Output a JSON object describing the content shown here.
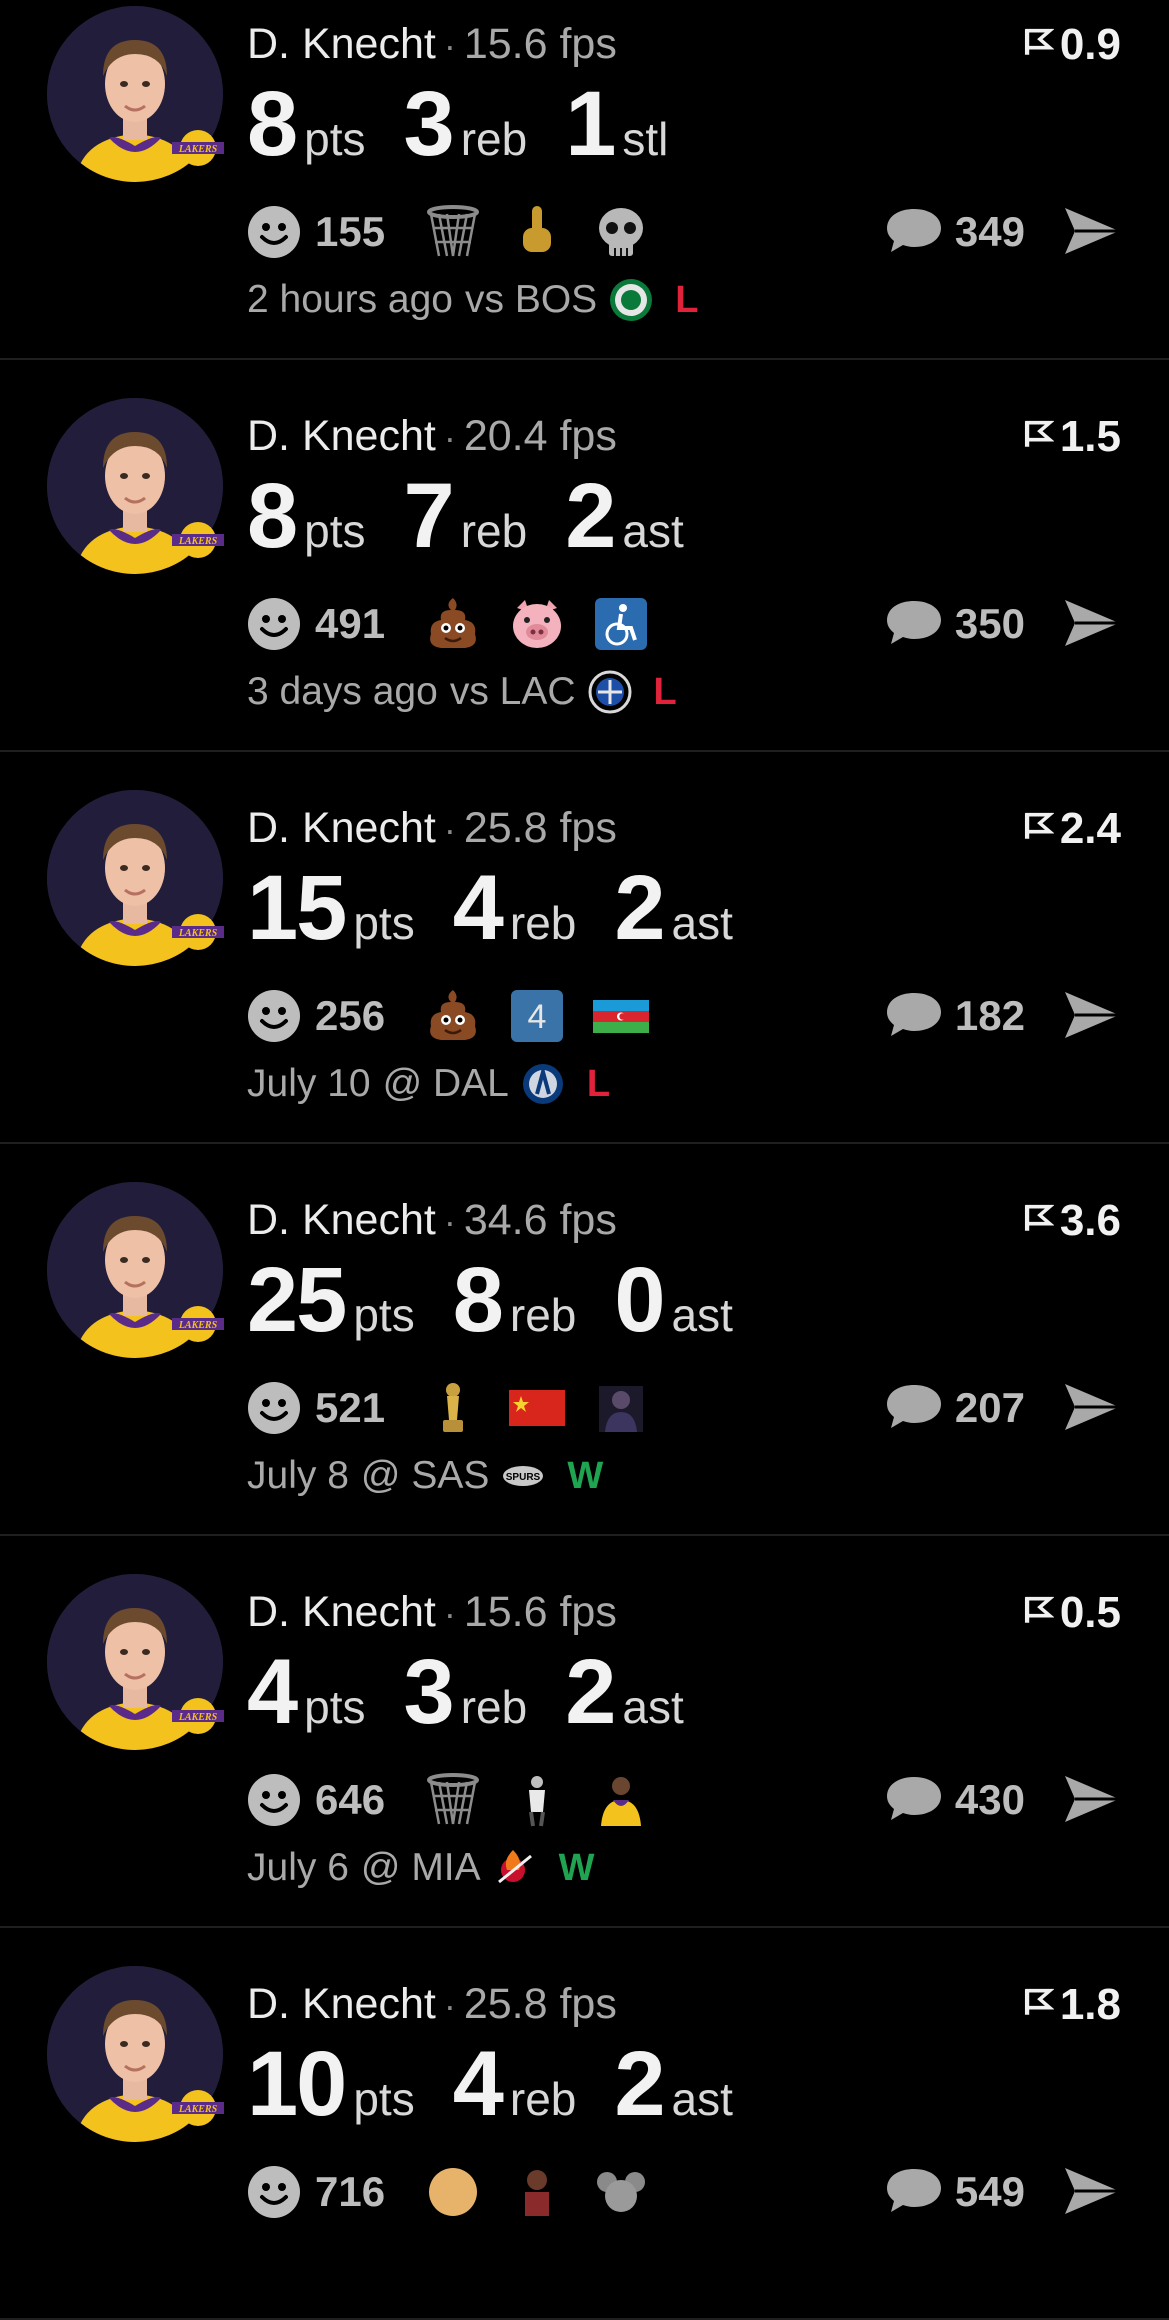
{
  "colors": {
    "background": "#000000",
    "loss": "#e0233a",
    "win": "#1fa552",
    "accent_purple": "#221d3a",
    "lakers_gold": "#f4c21c"
  },
  "posts": [
    {
      "player": "D. Knecht",
      "separator": "·",
      "fps": "15.6 fps",
      "rating": "0.9",
      "stats": [
        {
          "value": "8",
          "unit": "pts"
        },
        {
          "value": "3",
          "unit": "reb"
        },
        {
          "value": "1",
          "unit": "stl"
        }
      ],
      "reactions": "155",
      "emojis": [
        "basketball-hoop-icon",
        "middle-finger-icon",
        "skull-icon"
      ],
      "comments": "349",
      "time": "2 hours ago",
      "matchup": "vs BOS",
      "opponent_icon": "celtics-logo-icon",
      "result": "L"
    },
    {
      "player": "D. Knecht",
      "separator": "·",
      "fps": "20.4 fps",
      "rating": "1.5",
      "stats": [
        {
          "value": "8",
          "unit": "pts"
        },
        {
          "value": "7",
          "unit": "reb"
        },
        {
          "value": "2",
          "unit": "ast"
        }
      ],
      "reactions": "491",
      "emojis": [
        "poop-icon",
        "pig-face-icon",
        "wheelchair-icon"
      ],
      "comments": "350",
      "time": "3 days ago",
      "matchup": "vs LAC",
      "opponent_icon": "clippers-logo-icon",
      "result": "L"
    },
    {
      "player": "D. Knecht",
      "separator": "·",
      "fps": "25.8 fps",
      "rating": "2.4",
      "stats": [
        {
          "value": "15",
          "unit": "pts"
        },
        {
          "value": "4",
          "unit": "reb"
        },
        {
          "value": "2",
          "unit": "ast"
        }
      ],
      "reactions": "256",
      "emojis": [
        "poop-icon",
        "keycap-4-icon",
        "azerbaijan-flag-icon"
      ],
      "emoji_text": {
        "keycap": "4"
      },
      "comments": "182",
      "time": "July 10",
      "matchup": "@ DAL",
      "opponent_icon": "mavericks-logo-icon",
      "result": "L"
    },
    {
      "player": "D. Knecht",
      "separator": "·",
      "fps": "34.6 fps",
      "rating": "3.6",
      "stats": [
        {
          "value": "25",
          "unit": "pts"
        },
        {
          "value": "8",
          "unit": "reb"
        },
        {
          "value": "0",
          "unit": "ast"
        }
      ],
      "reactions": "521",
      "emojis": [
        "trophy-icon",
        "china-flag-icon",
        "player-photo-icon"
      ],
      "comments": "207",
      "time": "July 8",
      "matchup": "@ SAS",
      "opponent_icon": "spurs-logo-icon",
      "result": "W"
    },
    {
      "player": "D. Knecht",
      "separator": "·",
      "fps": "15.6 fps",
      "rating": "0.5",
      "stats": [
        {
          "value": "4",
          "unit": "pts"
        },
        {
          "value": "3",
          "unit": "reb"
        },
        {
          "value": "2",
          "unit": "ast"
        }
      ],
      "reactions": "646",
      "emojis": [
        "basketball-hoop-icon",
        "person-photo-icon",
        "lebron-photo-icon"
      ],
      "comments": "430",
      "time": "July 6",
      "matchup": "@ MIA",
      "opponent_icon": "heat-logo-icon",
      "result": "W"
    },
    {
      "player": "D. Knecht",
      "separator": "·",
      "fps": "25.8 fps",
      "rating": "1.8",
      "stats": [
        {
          "value": "10",
          "unit": "pts"
        },
        {
          "value": "4",
          "unit": "reb"
        },
        {
          "value": "2",
          "unit": "ast"
        }
      ],
      "reactions": "716",
      "emojis": [
        "face-icon",
        "person-icon",
        "mouse-icon"
      ],
      "comments": "549",
      "time": "",
      "matchup": "",
      "opponent_icon": "",
      "result": ""
    }
  ]
}
